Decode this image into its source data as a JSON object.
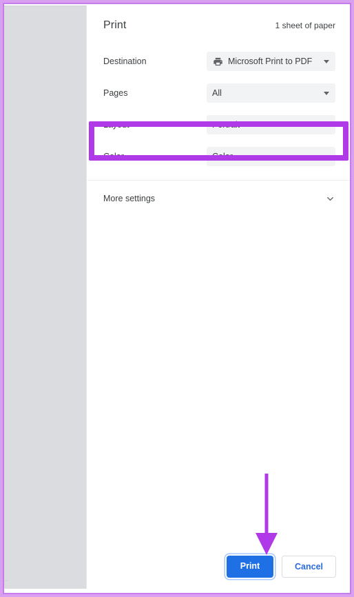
{
  "window": {
    "frame_color": "#d9a0f2",
    "preview_bg": "#dadce0",
    "preview_artifact": "..."
  },
  "header": {
    "title": "Print",
    "sheet_count": "1 sheet of paper"
  },
  "settings": {
    "rows": [
      {
        "label": "Destination",
        "value": "Microsoft Print to PDF",
        "icon": "printer-icon",
        "has_icon": true
      },
      {
        "label": "Pages",
        "value": "All",
        "icon": "",
        "has_icon": false
      },
      {
        "label": "Layout",
        "value": "Portrait",
        "icon": "",
        "has_icon": false
      },
      {
        "label": "Color",
        "value": "Color",
        "icon": "",
        "has_icon": false
      }
    ]
  },
  "more_settings": {
    "label": "More settings",
    "icon": "chevron-down-icon"
  },
  "annotations": {
    "highlight_color": "#b03ae8",
    "arrow_color": "#b03ae8",
    "highlight_target": "Layout",
    "arrow_target": "Print"
  },
  "footer": {
    "print_label": "Print",
    "cancel_label": "Cancel",
    "print_color": "#1f6fe5",
    "cancel_text_color": "#2a6ae0"
  }
}
